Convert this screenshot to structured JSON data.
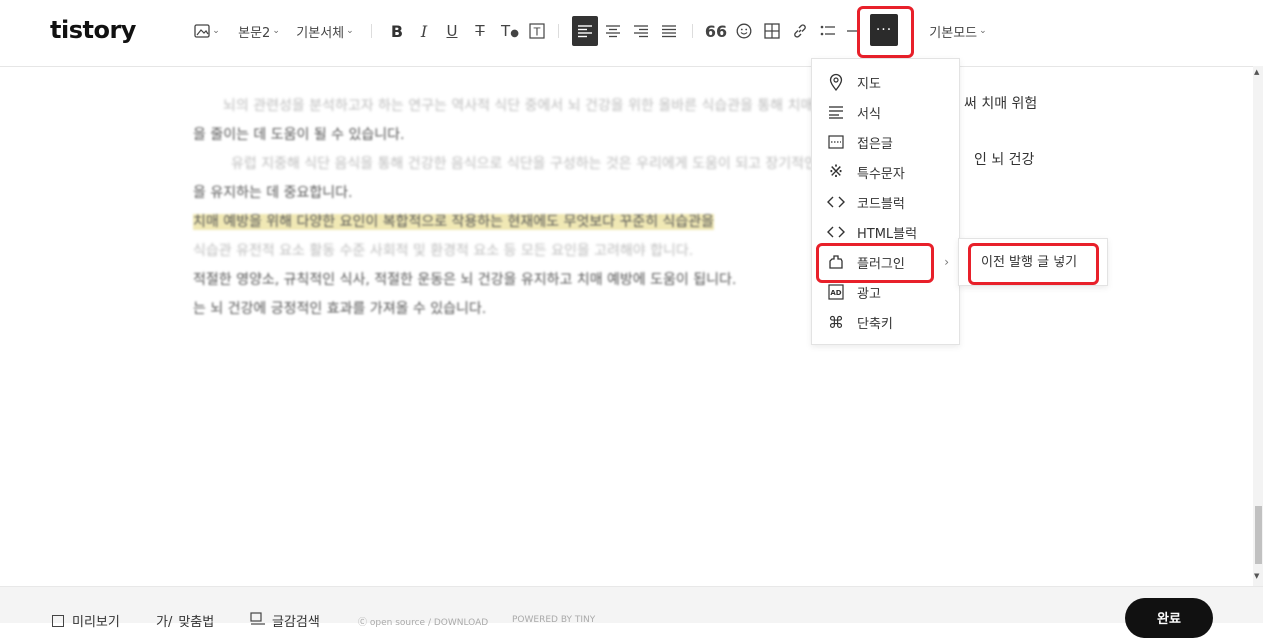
{
  "logo": "tistory",
  "toolbar": {
    "paragraph": "본문2",
    "font": "기본서체",
    "mode": "기본모드",
    "more": "···"
  },
  "content": {
    "lines": [
      "뇌의 관련성을 분석하고자 하는 연구는 역사적 식단 중에서 뇌 건강을 위한 올바른 식습관을 통해 치매 위험",
      "을 줄이는 데 도움이 될 수 있습니다.",
      "유럽 지중해 식단 음식을 통해 건강한 음식으로 식단을 구성하는 것은 우리에게 도움이 되고 장기적인 뇌 건강",
      "을 유지하는 데 중요합니다.",
      "치매 예방을 위해 다양한 요인이 복합적으로 작용하는 현재에도 무엇보다 꾸준히 식습관을",
      "식습관 유전적 요소 활동 수준 사회적 및 환경적 요소 등 모든 요인을 고려해야 합니다.",
      "적절한 영양소, 규칙적인 식사, 적절한 운동은 뇌 건강을 유지하고 치매 예방에 도움이 됩니다.",
      "는 뇌 건강에 긍정적인 효과를 가져올 수 있습니다."
    ],
    "visible_fragments": [
      "써 치매 위험",
      "인 뇌 건강"
    ]
  },
  "more_menu": {
    "items": [
      {
        "label": "지도",
        "icon": "map-pin-icon"
      },
      {
        "label": "서식",
        "icon": "format-icon"
      },
      {
        "label": "접은글",
        "icon": "folded-text-icon"
      },
      {
        "label": "특수문자",
        "icon": "special-char-icon"
      },
      {
        "label": "코드블럭",
        "icon": "code-icon"
      },
      {
        "label": "HTML블럭",
        "icon": "html-icon"
      },
      {
        "label": "플러그인",
        "icon": "plugin-icon"
      },
      {
        "label": "광고",
        "icon": "ad-icon"
      },
      {
        "label": "단축키",
        "icon": "command-icon"
      }
    ]
  },
  "plugin_submenu": {
    "item": "이전 발행 글 넣기"
  },
  "footer": {
    "preview": "미리보기",
    "spellcheck": "맞춤법",
    "search": "글감검색",
    "open_source": "open source / DOWNLOAD",
    "powered": "POWERED BY TINY",
    "done": "완료"
  },
  "colors": {
    "highlight": "#e8202a",
    "dark_button": "#2b2b2b",
    "done_button": "#111111"
  }
}
